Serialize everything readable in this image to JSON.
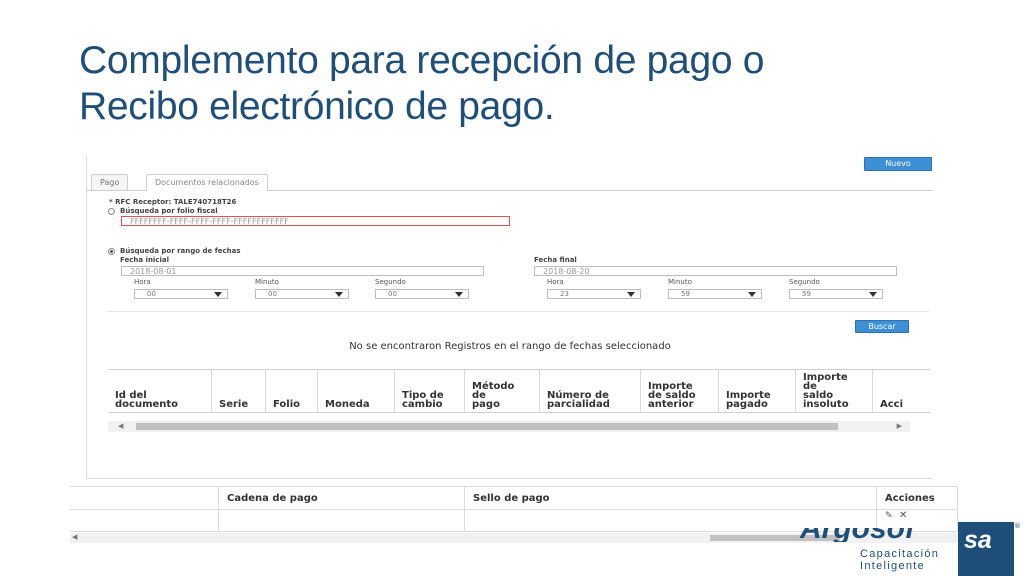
{
  "slide": {
    "title_line1": "Complemento para recepción de pago o",
    "title_line2": "Recibo electrónico de pago."
  },
  "toolbar": {
    "new_label": "Nuevo",
    "search_label": "Buscar"
  },
  "tabs": [
    {
      "label": "Pago",
      "active": false
    },
    {
      "label": "Documentos relacionados",
      "active": true
    }
  ],
  "form": {
    "rfc_label": "* RFC Receptor: TALE740718T26",
    "folio_option": "Búsqueda por folio fiscal",
    "folio_value": "FFFFFFFF-FFFF-FFFF-FFFF-FFFFFFFFFFFF",
    "range_option": "Búsqueda por rango de fechas",
    "start_label": "Fecha inicial",
    "start_value": "2018-08-01",
    "end_label": "Fecha final",
    "end_value": "2018-08-20",
    "start_time": {
      "hour_label": "Hora",
      "hour": "00",
      "minute_label": "Minuto",
      "minute": "00",
      "second_label": "Segundo",
      "second": "00"
    },
    "end_time": {
      "hour_label": "Hora",
      "hour": "23",
      "minute_label": "Minuto",
      "minute": "59",
      "second_label": "Segundo",
      "second": "59"
    }
  },
  "message": "No se encontraron Registros en el rango de fechas seleccionado",
  "grid": {
    "columns": [
      "Id del\ndocumento",
      "Serie",
      "Folio",
      "Moneda",
      "Tipo de\ncambio",
      "Método\nde\npago",
      "Número de\nparcialidad",
      "Importe\nde saldo\nanterior",
      "Importe\npagado",
      "Importe\nde\nsaldo\ninsoluto",
      "Acci"
    ]
  },
  "bottom_table": {
    "columns": [
      "Cadena de pago",
      "Sello de pago",
      "Acciones"
    ]
  },
  "icons": {
    "edit": "edit-icon",
    "delete": "close-icon"
  },
  "logo": {
    "line1": "Capacitación",
    "line2": "Inteligente",
    "box_text": "sa",
    "partial_text": "Argosof"
  },
  "colors": {
    "title": "#1f4e79",
    "button": "#3d8fd6",
    "error_border": "#d9534f"
  }
}
